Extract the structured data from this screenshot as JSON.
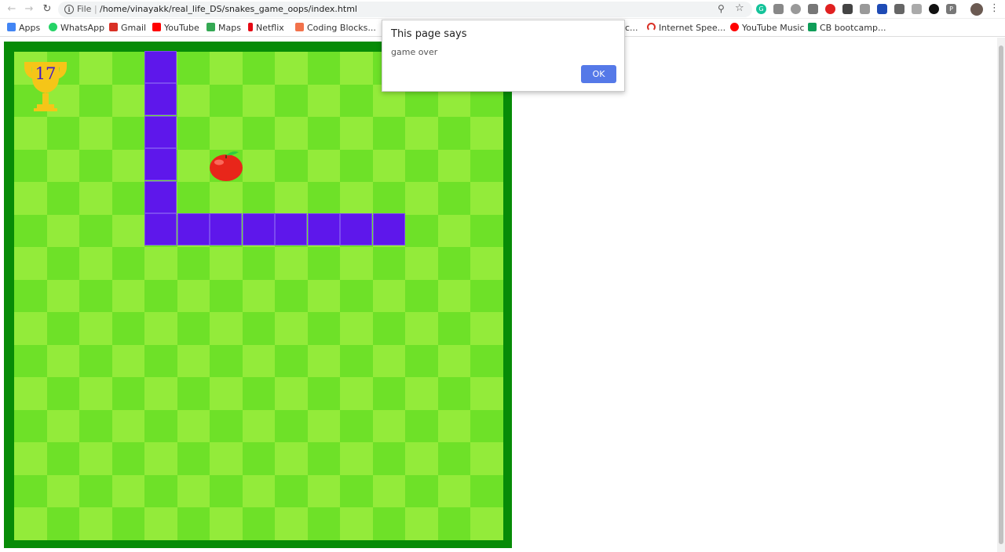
{
  "browser": {
    "scheme_label": "File",
    "separator": "|",
    "url": "/home/vinayakk/real_life_DS/snakes_game_oops/index.html",
    "back_icon": "arrow-left-icon",
    "forward_icon": "arrow-right-icon",
    "reload_icon": "reload-icon"
  },
  "bookmarks": [
    {
      "label": "Apps",
      "icon": "apps-grid-icon",
      "color": "#4285f4"
    },
    {
      "label": "WhatsApp",
      "icon": "whatsapp-icon",
      "color": "#25d366"
    },
    {
      "label": "Gmail",
      "icon": "gmail-icon",
      "color": "#d93025"
    },
    {
      "label": "YouTube",
      "icon": "youtube-icon",
      "color": "#ff0000"
    },
    {
      "label": "Maps",
      "icon": "maps-icon",
      "color": "#34a853"
    },
    {
      "label": "Netflix",
      "icon": "netflix-icon",
      "color": "#e50914"
    },
    {
      "label": "Coding Blocks...",
      "icon": "coding-blocks-icon",
      "color": "#f2724b"
    },
    {
      "label": "c...",
      "icon": "bookmark-icon",
      "color": "#333333"
    },
    {
      "label": "Internet Spee...",
      "icon": "speedometer-icon",
      "color": "#d93025"
    },
    {
      "label": "YouTube Music",
      "icon": "youtube-music-icon",
      "color": "#ff0000"
    },
    {
      "label": "CB bootcamp...",
      "icon": "sheets-icon",
      "color": "#0f9d58"
    }
  ],
  "game": {
    "score": "17",
    "grid_cols": 15,
    "grid_rows": 15,
    "colors": {
      "border": "#078b07",
      "light": "#93eb3a",
      "dark": "#6ee128",
      "snake": "#5e17eb",
      "apple": "#e8261a",
      "trophy": "#f5c518"
    },
    "snake_cells": [
      [
        4,
        0
      ],
      [
        4,
        1
      ],
      [
        4,
        2
      ],
      [
        4,
        3
      ],
      [
        4,
        4
      ],
      [
        4,
        5
      ],
      [
        5,
        5
      ],
      [
        6,
        5
      ],
      [
        7,
        5
      ],
      [
        8,
        5
      ],
      [
        9,
        5
      ],
      [
        10,
        5
      ],
      [
        11,
        5
      ]
    ],
    "food_cell": [
      6,
      3
    ]
  },
  "dialog": {
    "title": "This page says",
    "message": "game over",
    "ok_label": "OK"
  }
}
